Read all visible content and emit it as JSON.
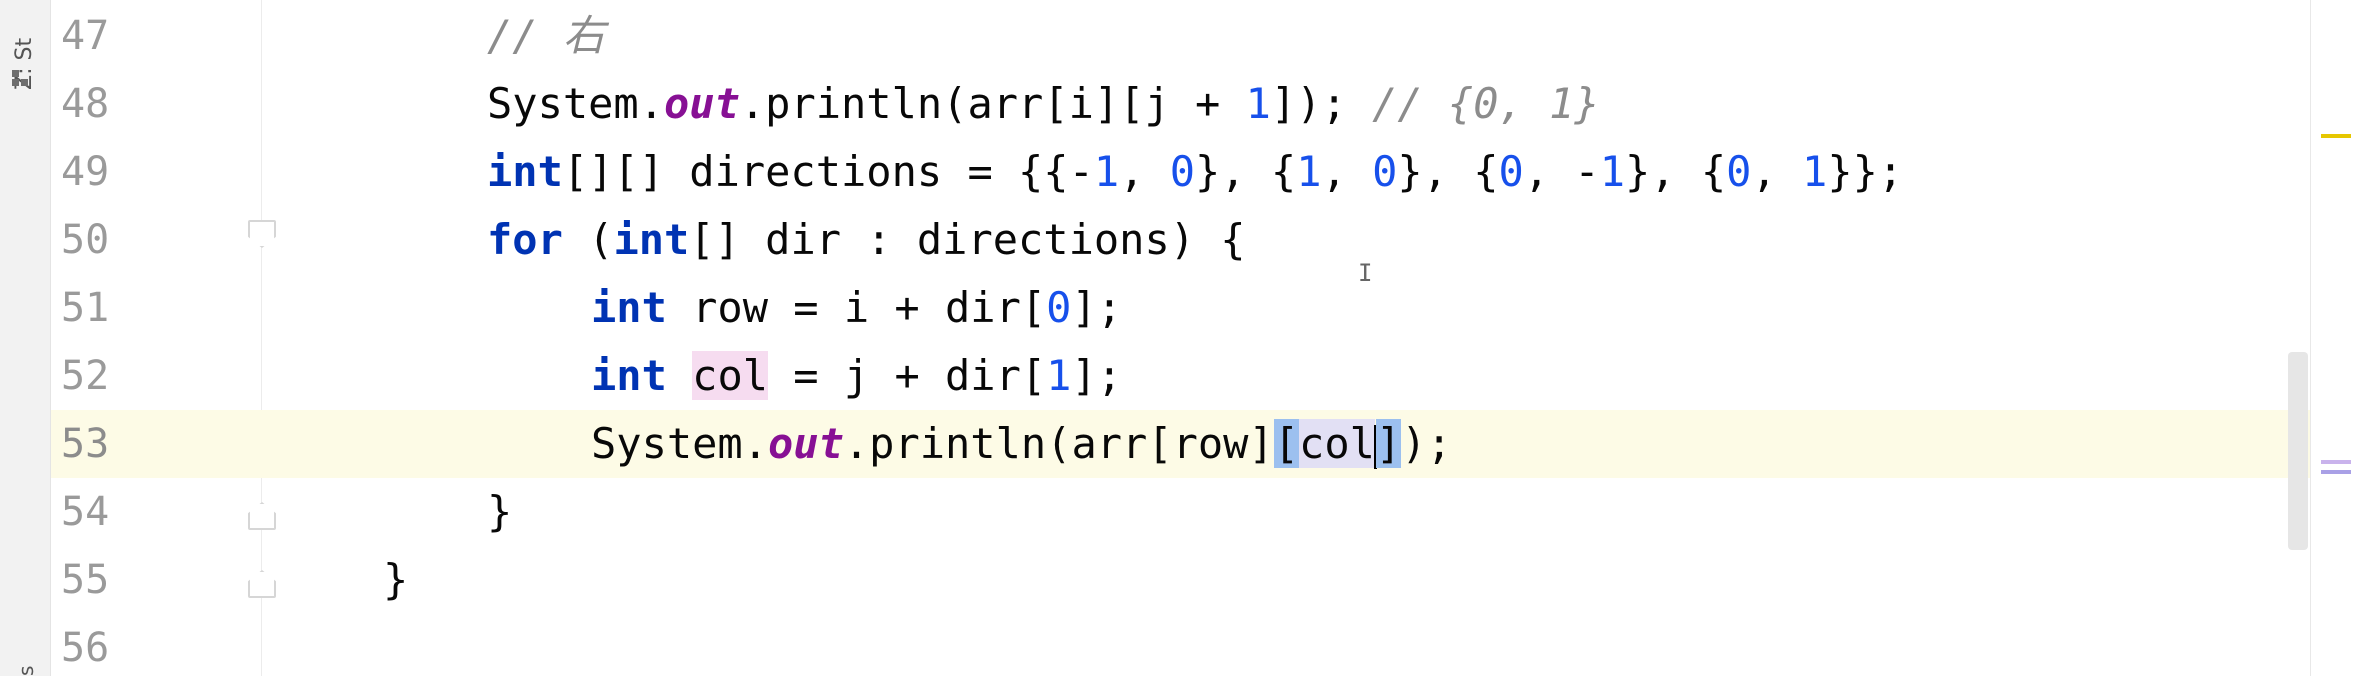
{
  "tool_window": {
    "label": "Z: St",
    "bottom_label": "s"
  },
  "editor": {
    "current_line": "53",
    "lines": [
      {
        "num": "47",
        "comment": "// 右"
      },
      {
        "num": "48",
        "t1": "System.",
        "t2": "out",
        "t3": ".println(arr[i][j + ",
        "n1": "1",
        "t4": "]); ",
        "comment": "// {0, 1}"
      },
      {
        "num": "49",
        "kw": "int",
        "t1": "[][] directions = {{-",
        "n1": "1",
        "t2": ", ",
        "n2": "0",
        "t3": "}, {",
        "n3": "1",
        "t4": ", ",
        "n4": "0",
        "t5": "}, {",
        "n5": "0",
        "t6": ", -",
        "n6": "1",
        "t7": "}, {",
        "n7": "0",
        "t8": ", ",
        "n8": "1",
        "t9": "}};"
      },
      {
        "num": "50",
        "kw1": "for",
        "t1": " (",
        "kw2": "int",
        "t2": "[] dir : directions) {"
      },
      {
        "num": "51",
        "kw": "int",
        "t1": " row = i + dir[",
        "n1": "0",
        "t2": "];"
      },
      {
        "num": "52",
        "kw": "int",
        "var": "col",
        "t1": " = j + dir[",
        "n1": "1",
        "t2": "];"
      },
      {
        "num": "53",
        "t1": "System.",
        "t2": "out",
        "t3": ".println(arr[row]",
        "b1": "[",
        "s1": "col",
        "b2": "]",
        "t4": ");"
      },
      {
        "num": "54",
        "t1": "}"
      },
      {
        "num": "55",
        "t1": "}"
      },
      {
        "num": "56"
      }
    ]
  },
  "colors": {
    "keyword": "#0033b3",
    "number": "#1750eb",
    "comment": "#8c8c8c",
    "static_field": "#871094",
    "current_line_bg": "#fdfbe6",
    "warning_marker": "#e6c700",
    "usage_marker": "#b7a2e0"
  }
}
